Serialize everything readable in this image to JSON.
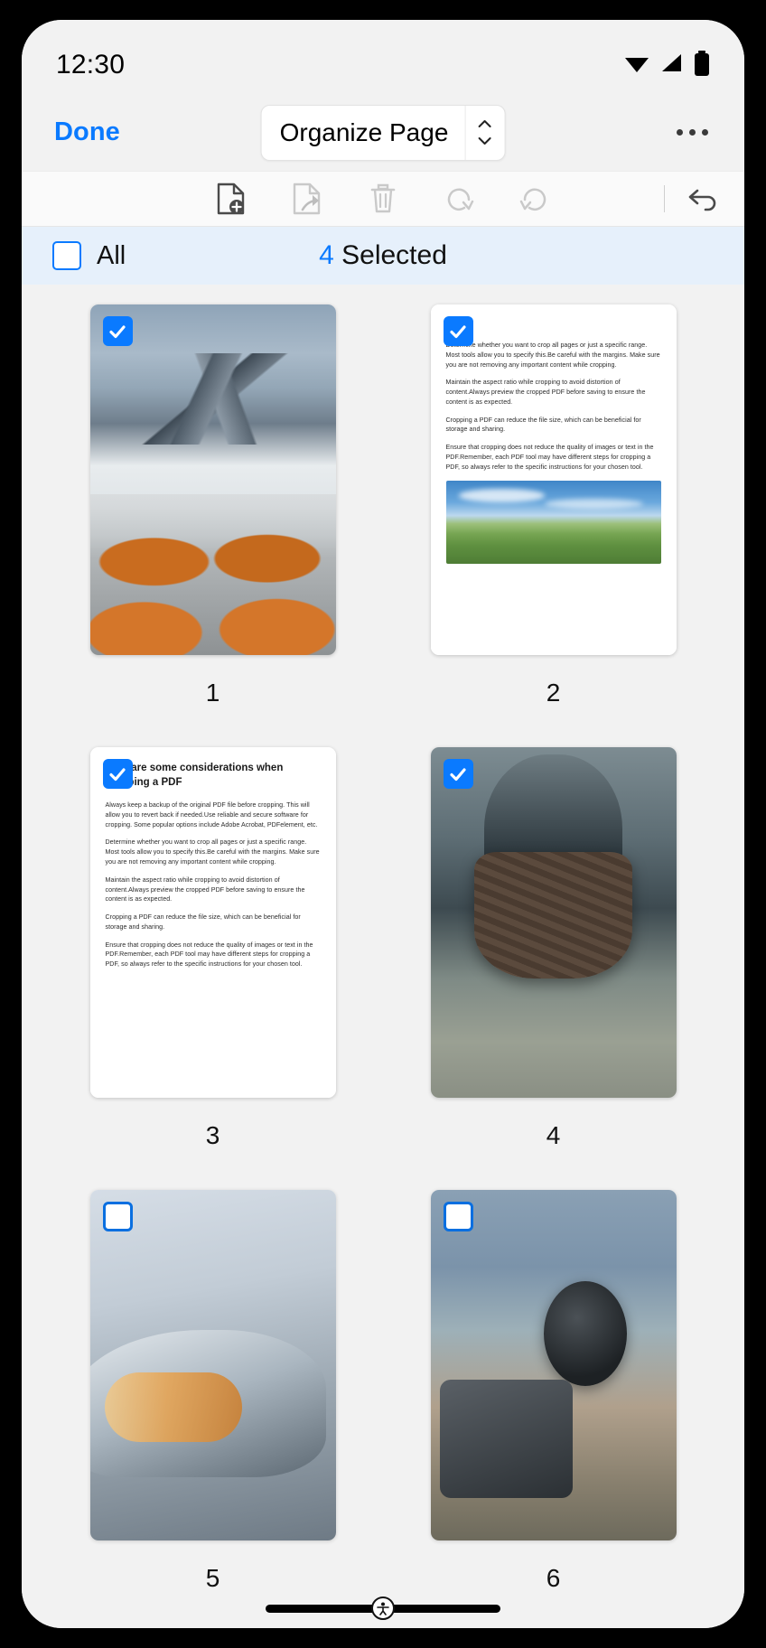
{
  "status_bar": {
    "time": "12:30",
    "icons": [
      "wifi-icon",
      "cellular-signal-icon",
      "battery-icon"
    ]
  },
  "nav_bar": {
    "done_label": "Done",
    "title": "Organize Page",
    "stepper_icon": "chevron-up-down-icon",
    "more_icon": "more-options-icon"
  },
  "tool_bar": {
    "tools": [
      {
        "name": "insert-page-icon",
        "enabled": true
      },
      {
        "name": "extract-page-icon",
        "enabled": false
      },
      {
        "name": "delete-page-icon",
        "enabled": false
      },
      {
        "name": "rotate-right-icon",
        "enabled": false
      },
      {
        "name": "rotate-left-icon",
        "enabled": false
      }
    ],
    "undo_icon": "undo-icon"
  },
  "selection_bar": {
    "all_label": "All",
    "all_checked": false,
    "selected_count": "4",
    "selected_suffix": " Selected",
    "accent_color": "#0a7aff",
    "background_color": "#e6f0fb"
  },
  "pages": [
    {
      "number": "1",
      "selected": true,
      "kind": "image",
      "art": "art-mountain",
      "alt": "aerial mountain view with hiker boots"
    },
    {
      "number": "2",
      "selected": true,
      "kind": "document",
      "heading": "",
      "paragraphs": [
        "Determine whether you want to crop all pages or just a specific range. Most tools allow you to specify this.Be careful with the margins. Make sure you are not removing any important content while cropping.",
        "Maintain the aspect ratio while cropping to avoid distortion of content.Always preview the cropped PDF before saving to ensure the content is as expected.",
        "Cropping a PDF can reduce the file size, which can be beneficial for storage and sharing.",
        "Ensure that cropping does not reduce the quality of images or text in the PDF.Remember, each PDF tool may have different steps for cropping a PDF, so always refer to the specific instructions for your chosen tool."
      ],
      "has_image": true,
      "image_alt": "green field under blue sky"
    },
    {
      "number": "3",
      "selected": true,
      "kind": "document",
      "heading": "Here are some considerations when cropping a PDF",
      "paragraphs": [
        "Always keep a backup of the original PDF file before cropping. This will allow you to revert back if needed.Use reliable and secure software for cropping. Some popular options include Adobe Acrobat, PDFelement, etc.",
        "Determine whether you want to crop all pages or just a specific range. Most tools allow you to specify this.Be careful with the margins. Make sure you are not removing any important content while cropping.",
        "Maintain the aspect ratio while cropping to avoid distortion of content.Always preview the cropped PDF before saving to ensure the content is as expected.",
        "Cropping a PDF can reduce the file size, which can be beneficial for storage and sharing.",
        "Ensure that cropping does not reduce the quality of images or text in the PDF.Remember, each PDF tool may have different steps for cropping a PDF, so always refer to the specific instructions for your chosen tool."
      ],
      "has_image": false
    },
    {
      "number": "4",
      "selected": true,
      "kind": "image",
      "art": "art-shoe",
      "alt": "running shoe splashing through water"
    },
    {
      "number": "5",
      "selected": false,
      "kind": "image",
      "art": "art-car",
      "alt": "car headlight close up"
    },
    {
      "number": "6",
      "selected": false,
      "kind": "image",
      "art": "art-moto",
      "alt": "motorcyclist with helmet on mountain road"
    }
  ],
  "home_indicator": {
    "nav_dot_icon": "accessibility-nav-icon"
  }
}
